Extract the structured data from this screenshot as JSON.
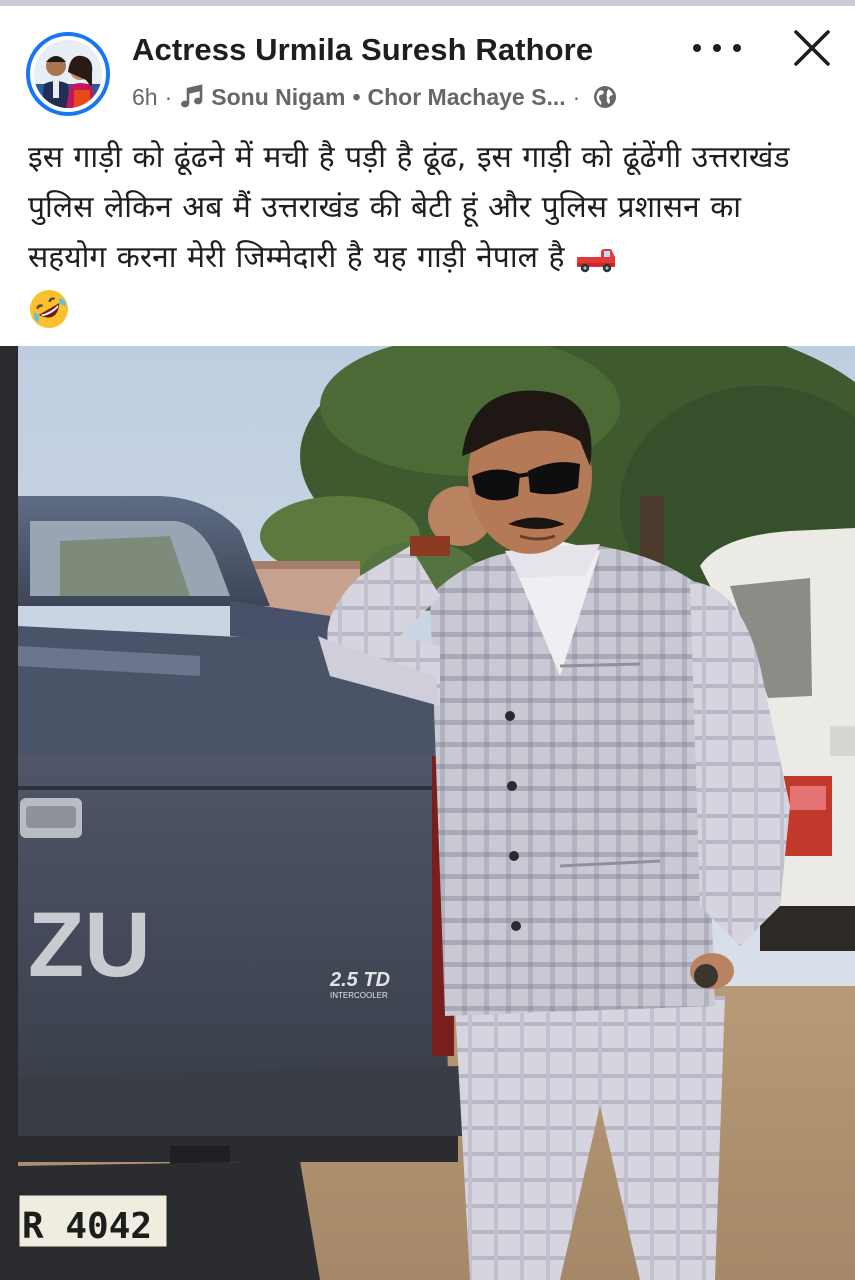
{
  "post": {
    "author": "Actress Urmila Suresh Rathore",
    "time": "6h",
    "separator": "·",
    "song_artist": "Sonu Nigam",
    "song_dot": "•",
    "song_title": "Chor Machaye S...",
    "separator2": "·",
    "caption": "इस गाड़ी को ढूंढने में मची है पड़ी है ढूंढ, इस गाड़ी को ढूंढेंगी उत्तराखंड पुलिस लेकिन अब मैं उत्तराखंड की बेटी हूं और पुलिस प्रशासन का सहयोग करना मेरी जिम्मेदारी है यह गाड़ी नेपाल है",
    "caption_emojis": [
      "pickup-truck",
      "rolling-laughing-face"
    ]
  },
  "photo": {
    "tailgate_text": "ZU",
    "badge_text": "2.5 TD",
    "badge_sub": "INTERCOOLER",
    "plate_text": "R 4042"
  },
  "icons": {
    "more": "more-horizontal-icon",
    "close": "close-icon",
    "music": "music-note-icon",
    "privacy": "globe-icon"
  },
  "colors": {
    "accent": "#1877f2",
    "text_primary": "#1c1e21",
    "text_secondary": "#65676b"
  }
}
